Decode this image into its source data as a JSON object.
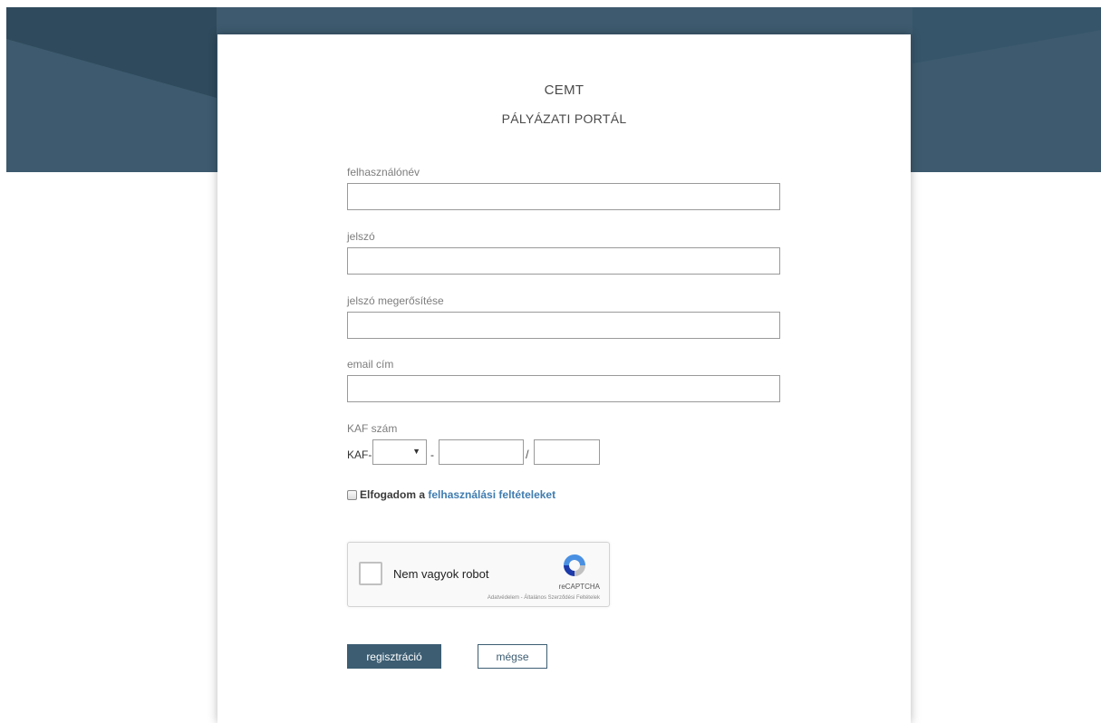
{
  "colors": {
    "header_bg": "#3d5a6e",
    "header_accent": "#2f4a5c",
    "primary_button": "#3c5d72",
    "link": "#3f7cb0"
  },
  "brand": {
    "title": "CEMT",
    "subtitle": "PÁLYÁZATI PORTÁL"
  },
  "form": {
    "username_label": "felhasználónév",
    "password_label": "jelszó",
    "password_confirm_label": "jelszó megerősítése",
    "email_label": "email cím",
    "kaf_label": "KAF szám",
    "kaf_prefix": "KAF-",
    "kaf_dash": "-",
    "kaf_slash": "/",
    "kaf_select_arrow": "▼",
    "terms_prefix": "Elfogadom a",
    "terms_link": "felhasználási feltételeket"
  },
  "recaptcha": {
    "label": "Nem vagyok robot",
    "brand": "reCAPTCHA",
    "legal": "Adatvédelem - Általános Szerződési Feltételek",
    "icon": "recaptcha-logo-icon"
  },
  "buttons": {
    "register": "regisztráció",
    "cancel": "mégse"
  }
}
